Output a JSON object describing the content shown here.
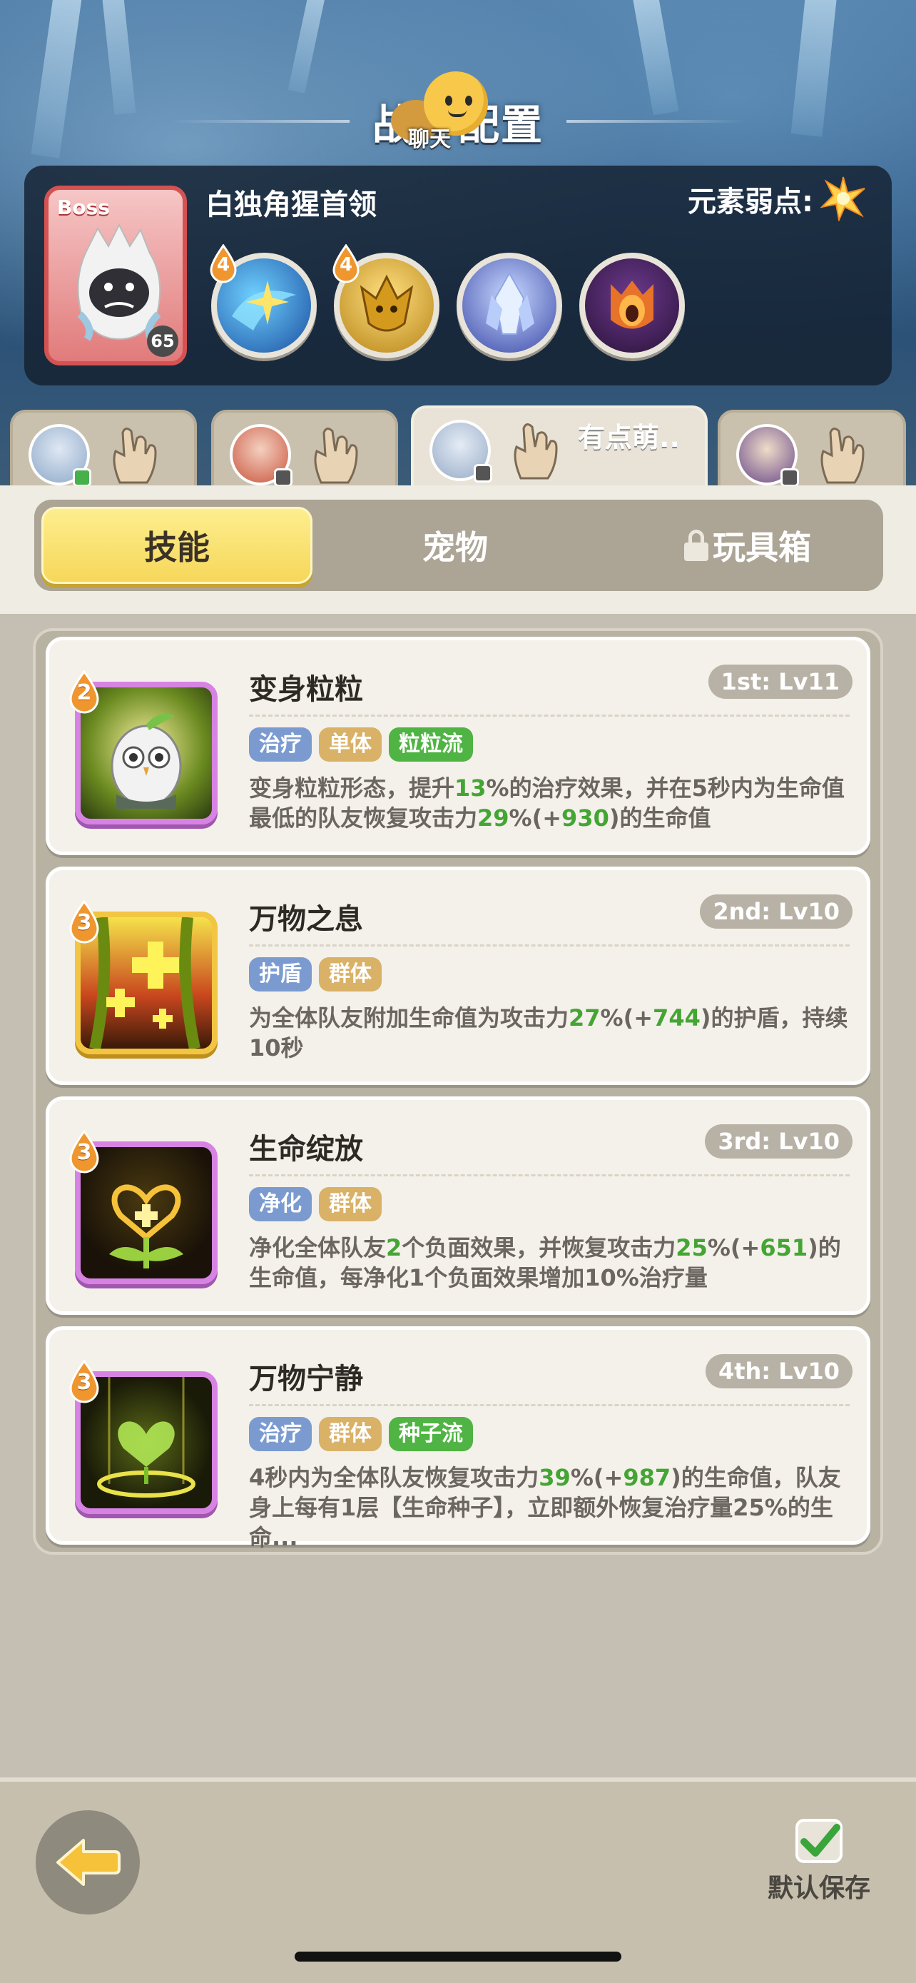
{
  "header": {
    "title": "战斗配置",
    "chat_label": "聊天"
  },
  "boss": {
    "tag": "Boss",
    "level": "65",
    "name": "白独角猩首领",
    "weakness_label": "元素弱点:",
    "traits": [
      {
        "badge": "4",
        "icon": "water-star-icon"
      },
      {
        "badge": "4",
        "icon": "golden-beast-icon"
      },
      {
        "badge": "",
        "icon": "ice-crystal-icon"
      },
      {
        "badge": "",
        "icon": "dark-mask-icon"
      }
    ]
  },
  "team_tabs": [
    {
      "name": ""
    },
    {
      "name": ""
    },
    {
      "name": "有点萌.."
    },
    {
      "name": ""
    }
  ],
  "tabs": {
    "skills": "技能",
    "pets": "宠物",
    "toybox": "玩具箱"
  },
  "skills": [
    {
      "cost": "2",
      "name": "变身粒粒",
      "rank": "1st: Lv11",
      "tags": [
        {
          "label": "治疗",
          "color": "blue"
        },
        {
          "label": "单体",
          "color": "gold"
        },
        {
          "label": "粒粒流",
          "color": "green"
        }
      ],
      "desc_parts": [
        {
          "t": "变身粒粒形态，提升"
        },
        {
          "t": "13",
          "n": true
        },
        {
          "t": "%的治疗效果，并在5秒内为生命值最低的队友恢复攻击力"
        },
        {
          "t": "29",
          "n": true
        },
        {
          "t": "%(+"
        },
        {
          "t": "930",
          "n": true
        },
        {
          "t": ")的生命值"
        }
      ]
    },
    {
      "cost": "3",
      "name": "万物之息",
      "rank": "2nd: Lv10",
      "tags": [
        {
          "label": "护盾",
          "color": "blue"
        },
        {
          "label": "群体",
          "color": "gold"
        }
      ],
      "desc_parts": [
        {
          "t": "为全体队友附加生命值为攻击力"
        },
        {
          "t": "27",
          "n": true
        },
        {
          "t": "%(+"
        },
        {
          "t": "744",
          "n": true
        },
        {
          "t": ")的护盾，持续10秒"
        }
      ]
    },
    {
      "cost": "3",
      "name": "生命绽放",
      "rank": "3rd: Lv10",
      "tags": [
        {
          "label": "净化",
          "color": "blue"
        },
        {
          "label": "群体",
          "color": "gold"
        }
      ],
      "desc_parts": [
        {
          "t": "净化全体队友"
        },
        {
          "t": "2",
          "n": true
        },
        {
          "t": "个负面效果，并恢复攻击力"
        },
        {
          "t": "25",
          "n": true
        },
        {
          "t": "%(+"
        },
        {
          "t": "651",
          "n": true
        },
        {
          "t": ")的生命值，每净化1个负面效果增加10%治疗量"
        }
      ]
    },
    {
      "cost": "3",
      "name": "万物宁静",
      "rank": "4th: Lv10",
      "tags": [
        {
          "label": "治疗",
          "color": "blue"
        },
        {
          "label": "群体",
          "color": "gold"
        },
        {
          "label": "种子流",
          "color": "green"
        }
      ],
      "desc_parts": [
        {
          "t": "4秒内为全体队友恢复攻击力"
        },
        {
          "t": "39",
          "n": true
        },
        {
          "t": "%(+"
        },
        {
          "t": "987",
          "n": true
        },
        {
          "t": ")的生命值，队友身上每有1层【生命种子】，立即额外恢复治疗量25%的生命..."
        }
      ]
    }
  ],
  "footer": {
    "save_label": "默认保存"
  },
  "colors": {
    "accent_yellow": "#f6d75a",
    "number_green": "#44a535",
    "tag_blue": "#7b9bd0",
    "tag_gold": "#d9b167",
    "tag_green": "#4fb443"
  }
}
